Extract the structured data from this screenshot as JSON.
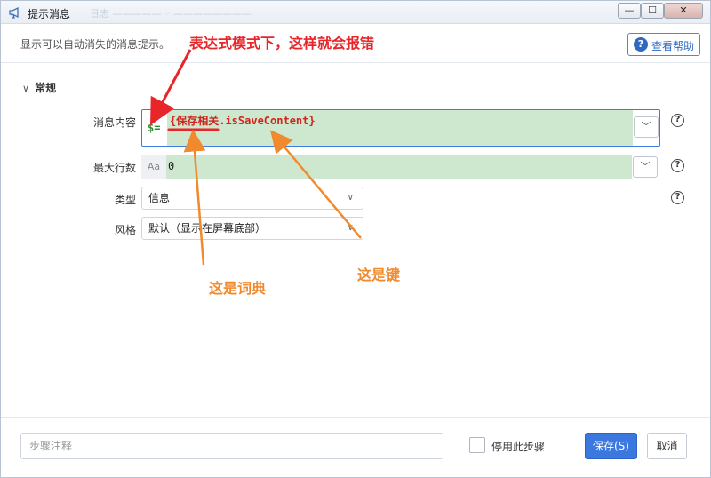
{
  "window": {
    "title": "提示消息",
    "ghost_title": "日志 ————— ◦ ————————",
    "minimize": "—",
    "maximize": "☐",
    "close": "✕"
  },
  "description": "显示可以自动消失的消息提示。",
  "help_button": {
    "icon": "?",
    "label": "查看帮助"
  },
  "section": {
    "chevron": "∨",
    "title": "常规"
  },
  "fields": {
    "message": {
      "label": "消息内容",
      "prefix": "$=",
      "value": "{保存相关.isSaveContent}",
      "help": "?"
    },
    "max_lines": {
      "label": "最大行数",
      "prefix": "Aa",
      "value": "0",
      "help": "?"
    },
    "type": {
      "label": "类型",
      "value": "信息",
      "help": "?"
    },
    "style": {
      "label": "风格",
      "value": "默认（显示在屏幕底部）"
    }
  },
  "footer": {
    "remark_placeholder": "步骤注释",
    "disable_label": "停用此步骤",
    "save_label": "保存(S)",
    "cancel_label": "取消"
  },
  "annotations": {
    "top": "表达式模式下，这样就会报错",
    "dict": "这是词典",
    "key": "这是键"
  },
  "colors": {
    "accent": "#3a78e0",
    "field_fill": "#cde8cf",
    "annotation_red": "#e8262a",
    "annotation_orange": "#f08a2c"
  }
}
